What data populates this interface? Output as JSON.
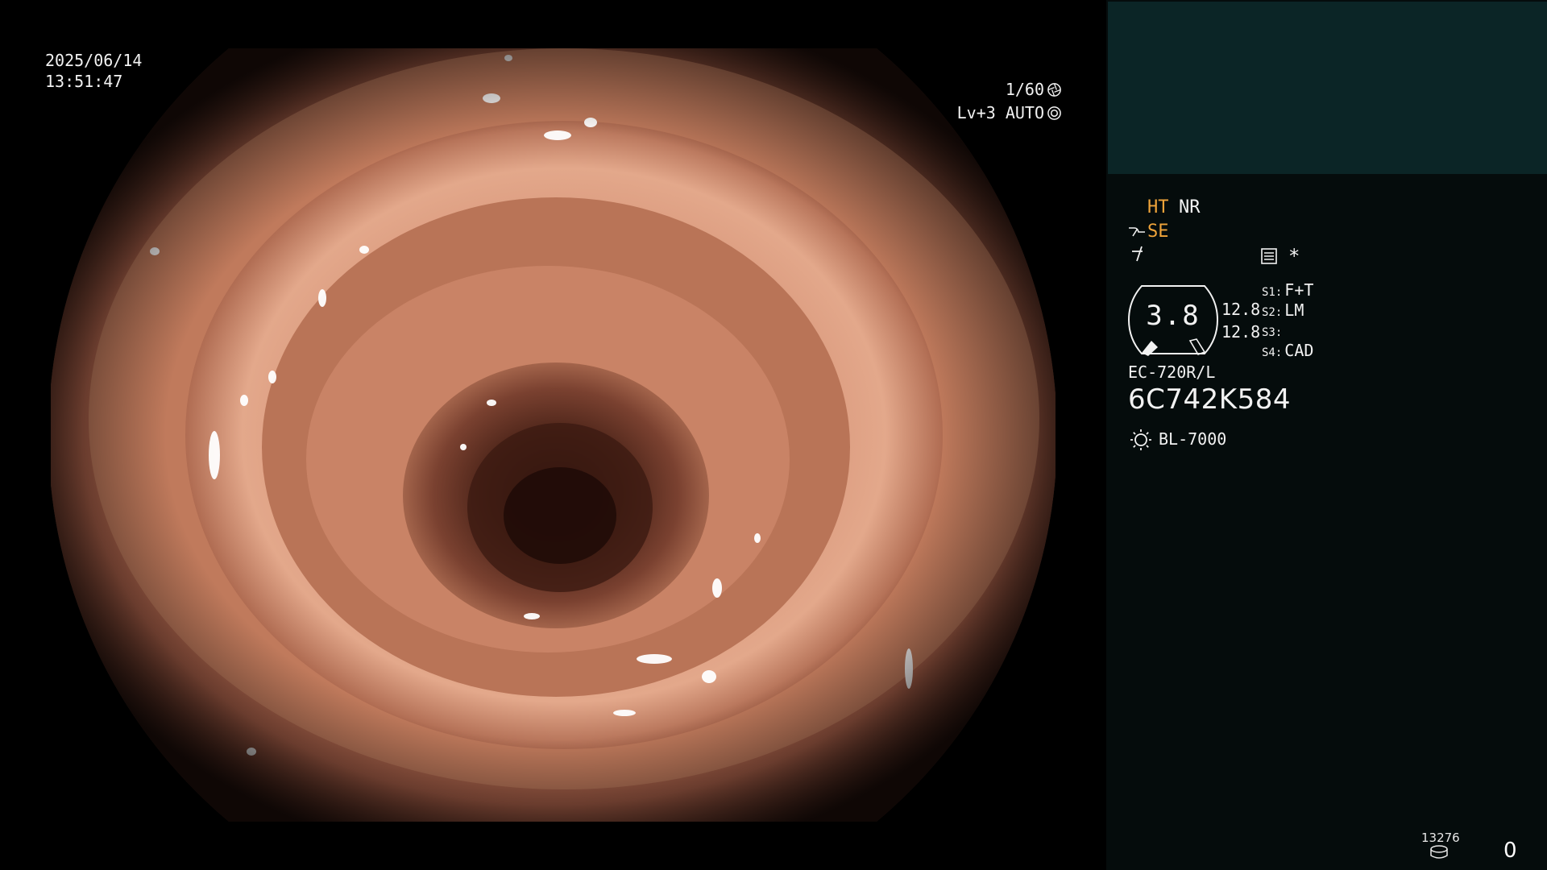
{
  "overlay": {
    "date": "2025/06/14",
    "time": "13:51:47",
    "shutter": "1/60",
    "shutter_icon": "iris-icon",
    "level": "Lv+3 AUTO",
    "level_icon": "aperture-icon"
  },
  "panel": {
    "ht": "HT",
    "nr": "NR",
    "se": "SE",
    "accent_color": "#f0a43a",
    "gauge_value": "3.8",
    "value_a": "12.8",
    "value_b": "12.8",
    "switches": [
      {
        "key": "S1:",
        "value": "F+T"
      },
      {
        "key": "S2:",
        "value": "LM"
      },
      {
        "key": "S3:",
        "value": ""
      },
      {
        "key": "S4:",
        "value": "CAD"
      }
    ],
    "asterisk": "*",
    "scope_model": "EC-720R/L",
    "scope_serial": "6C742K584",
    "light_source": "BL-7000",
    "counter_small": "13276",
    "counter_big": "0"
  }
}
